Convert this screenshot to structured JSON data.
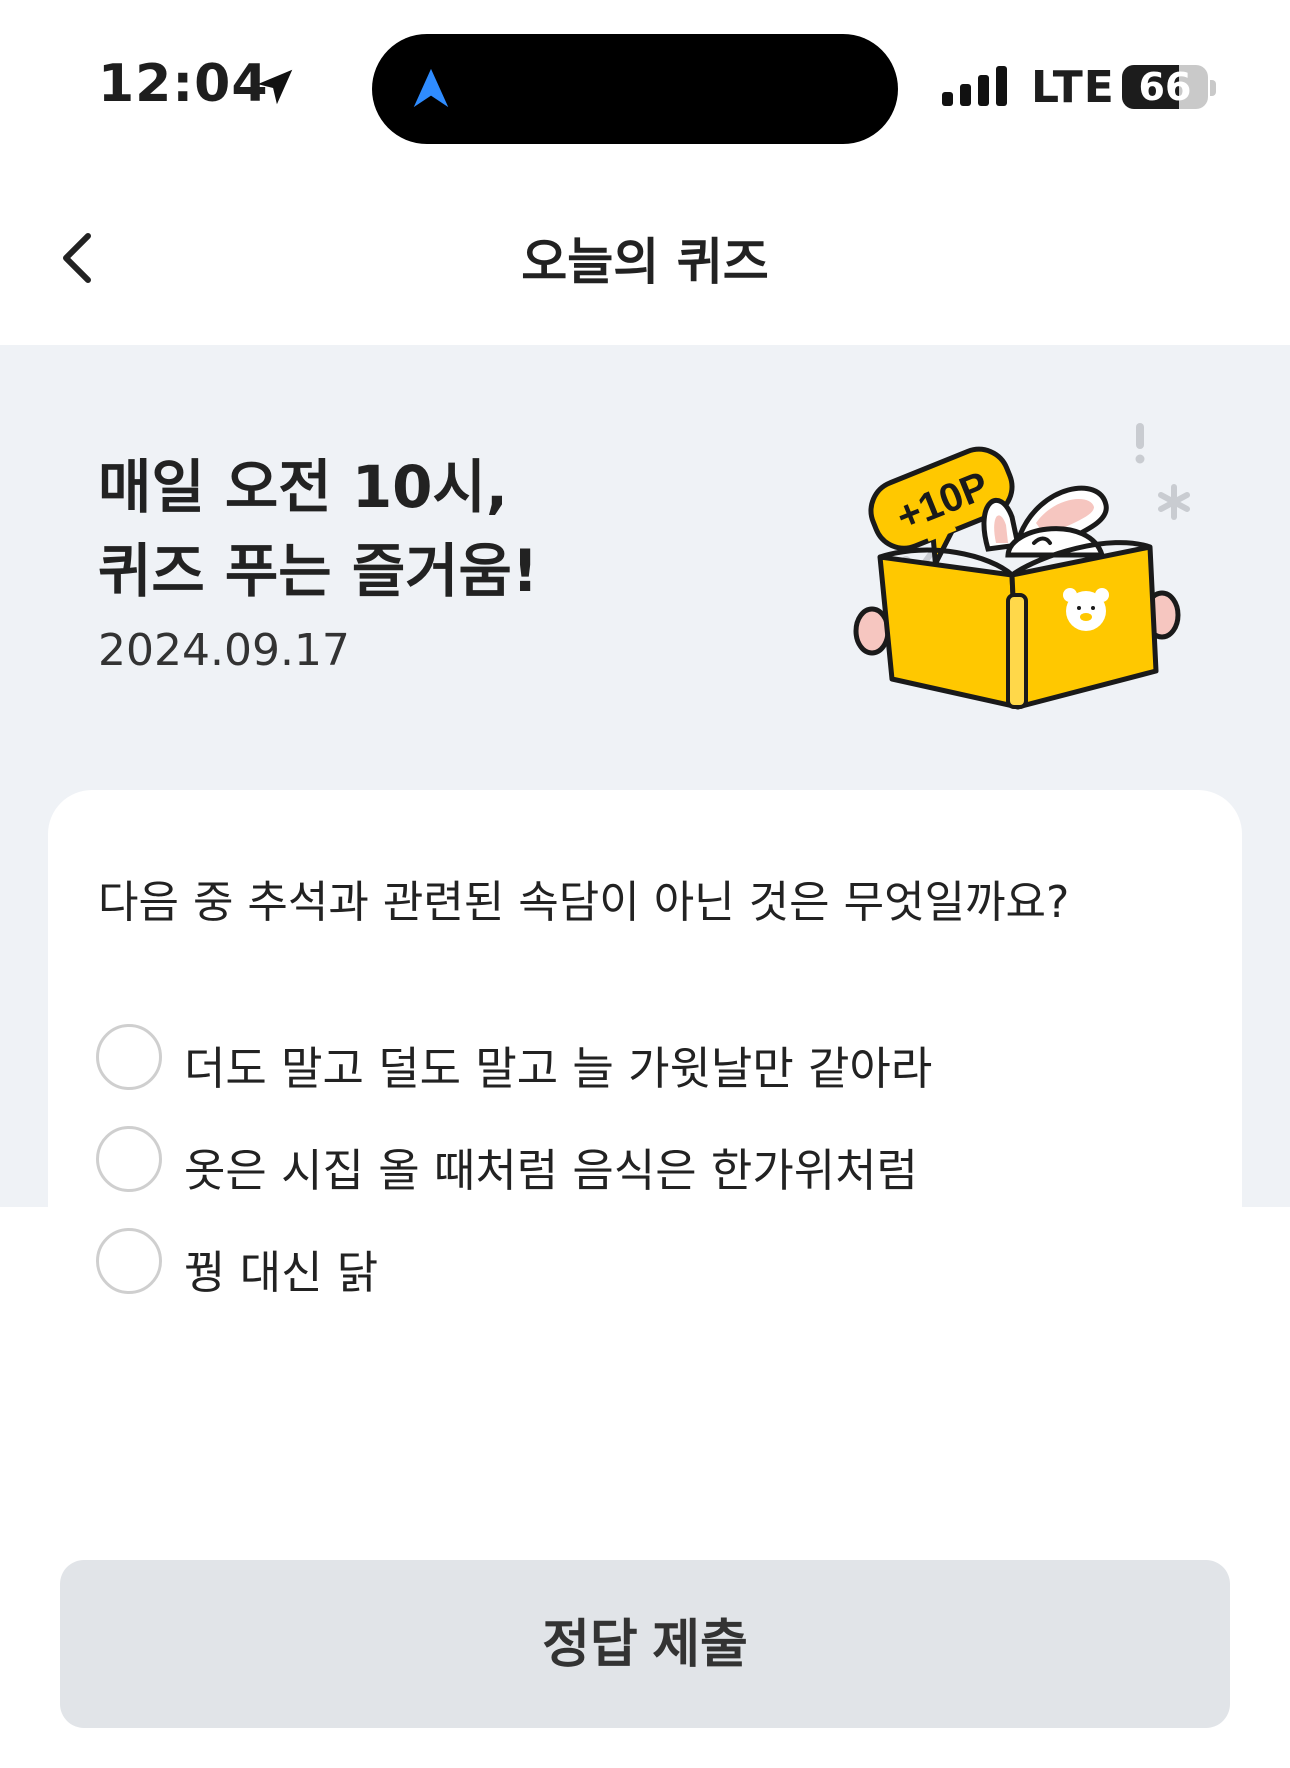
{
  "status_bar": {
    "time": "12:04",
    "network": "LTE",
    "battery_percent": "66",
    "battery_level": 0.66
  },
  "header": {
    "title": "오늘의 퀴즈"
  },
  "banner": {
    "headline_line1": "매일 오전 10시,",
    "headline_line2": "퀴즈 푸는 즐거움!",
    "date": "2024.09.17",
    "badge": "+10P"
  },
  "quiz": {
    "question": "다음 중 추석과 관련된 속담이 아닌 것은 무엇일까요?",
    "options": [
      "더도 말고 덜도 말고 늘 가윗날만 같아라",
      "옷은 시집 올 때처럼 음식은 한가위처럼",
      "꿩 대신 닭"
    ]
  },
  "actions": {
    "submit_label": "정답 제출"
  },
  "colors": {
    "banner_bg": "#eff2f6",
    "accent_yellow": "#ffc800",
    "button_bg": "#e1e4e8",
    "nav_arrow": "#2f8cff"
  }
}
